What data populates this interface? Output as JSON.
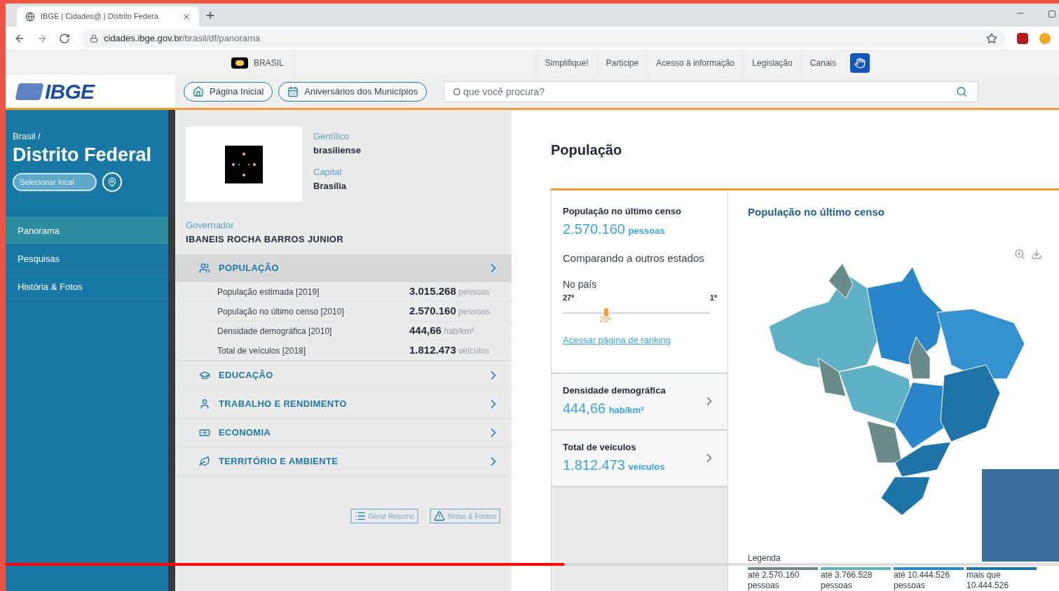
{
  "browser": {
    "tab_title": "IBGE | Cidades@ | Distrito Federa",
    "url_host": "cidades.ibge.gov.br",
    "url_path": "/brasil/df/panorama"
  },
  "gov_bar": {
    "country": "BRASIL",
    "links": [
      "Simplifique!",
      "Participe",
      "Acesso à informação",
      "Legislação",
      "Canais"
    ]
  },
  "header": {
    "logo": "IBGE",
    "nav": [
      {
        "label": "Página Inicial",
        "kind": "home"
      },
      {
        "label": "Aniversários dos Municípios",
        "kind": "calendar"
      }
    ],
    "search": {
      "placeholder": "O que você procura?"
    }
  },
  "sidebar": {
    "breadcrumb": "Brasil /",
    "title": "Distrito Federal",
    "select_placeholder": "Selecionar local",
    "items": [
      {
        "label": "Panorama",
        "selected": true
      },
      {
        "label": "Pesquisas",
        "selected": false
      },
      {
        "label": "História & Fotos",
        "selected": false
      }
    ]
  },
  "info": {
    "fields": [
      {
        "label": "Gentílico",
        "value": "brasiliense"
      },
      {
        "label": "Capital",
        "value": "Brasília"
      }
    ],
    "governor_label": "Governador",
    "governor": "IBANEIS ROCHA BARROS JUNIOR"
  },
  "sections": [
    {
      "title": "POPULAÇÃO",
      "kind": "people",
      "expanded": true,
      "rows": [
        {
          "label": "População estimada [2019]",
          "value": "3.015.268",
          "unit": "pessoas"
        },
        {
          "label": "População no último censo [2010]",
          "value": "2.570.160",
          "unit": "pessoas"
        },
        {
          "label": "Densidade demográfica [2010]",
          "value": "444,66",
          "unit": "hab/km²"
        },
        {
          "label": "Total de veículos [2018]",
          "value": "1.812.473",
          "unit": "veículos"
        }
      ]
    },
    {
      "title": "EDUCAÇÃO",
      "kind": "education",
      "expanded": false
    },
    {
      "title": "TRABALHO E RENDIMENTO",
      "kind": "work",
      "expanded": false
    },
    {
      "title": "ECONOMIA",
      "kind": "money",
      "expanded": false
    },
    {
      "title": "TERRITÓRIO E AMBIENTE",
      "kind": "leaf",
      "expanded": false
    }
  ],
  "panel_buttons": [
    {
      "label": "Gerar Resumo",
      "kind": "list"
    },
    {
      "label": "Notas & Fontes",
      "kind": "warning"
    }
  ],
  "detail": {
    "title": "População",
    "card": {
      "title": "População no último censo",
      "value": "2.570.160",
      "unit": "pessoas",
      "compare": "Comparando a outros estados",
      "scope": "No país",
      "rank_low": "27º",
      "rank_high": "1º",
      "rank": "20º",
      "level": 0.28,
      "link": "Acessar página de ranking"
    },
    "other_cards": [
      {
        "title": "Densidade demográfica",
        "value": "444,66",
        "unit": "hab/km²"
      },
      {
        "title": "Total de veículos",
        "value": "1.812.473",
        "unit": "veículos"
      }
    ],
    "map_title": "População no último censo",
    "legend_title": "Legenda",
    "legend": [
      {
        "label": "até 2.570.160 pessoas",
        "color": "#6b8a8a"
      },
      {
        "label": "até 3.766.528 pessoas",
        "color": "#5fb0c4"
      },
      {
        "label": "até 10.444.526 pessoas",
        "color": "#2a86c9"
      },
      {
        "label": "mais que 10.444.526",
        "color": "#1e74a6"
      }
    ]
  },
  "player": {
    "progress": {
      "level": 0.53
    }
  }
}
